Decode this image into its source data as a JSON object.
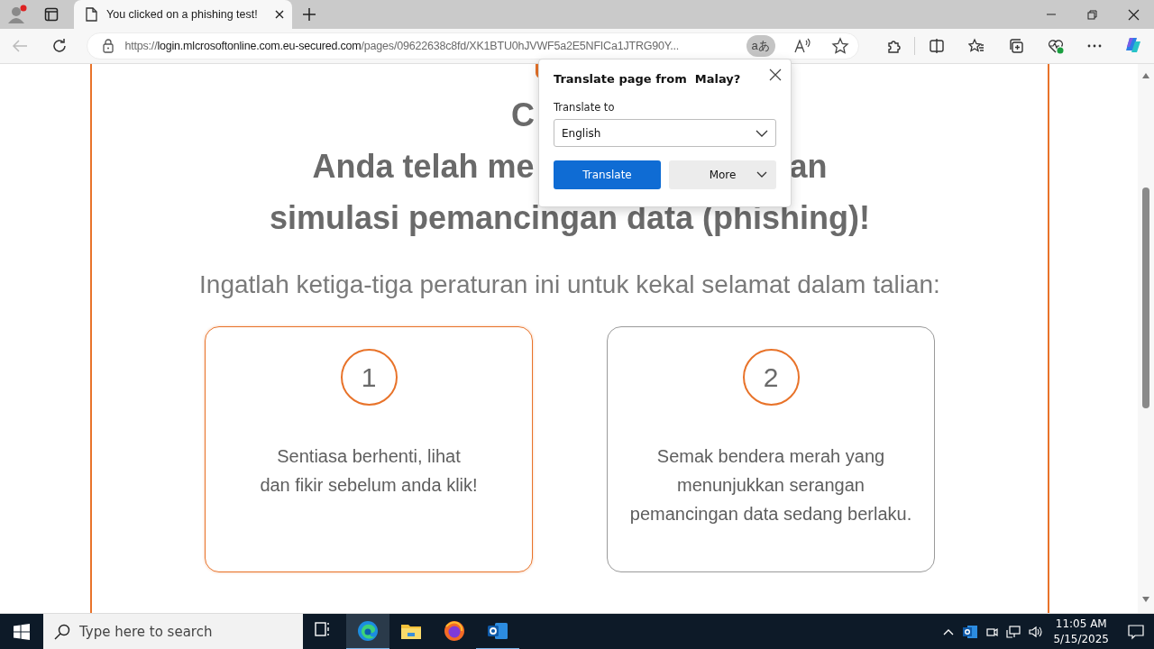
{
  "browser": {
    "tabs": [
      {
        "title": "You clicked on a phishing test!",
        "selected": true
      }
    ],
    "address": {
      "scheme": "https://",
      "host": "login.mlcrosoftonline.com.eu-secured.com",
      "path": "/pages/09622638c8fd/XK1BTU0hJVWF5a2E5NFICa1JTRG90Y..."
    },
    "translate_badge": "aあ"
  },
  "page": {
    "heading": {
      "line_1": "C",
      "line_2_left": "Anda telah me",
      "line_2_right": "an",
      "line_3": "simulasi pemancingan data (phishing)!"
    },
    "subtitle": "Ingatlah ketiga-tiga peraturan ini untuk kekal selamat dalam talian:",
    "cards": [
      {
        "number": "1",
        "text": "Sentiasa berhenti, lihat\ndan fikir sebelum anda klik!",
        "highlighted": true
      },
      {
        "number": "2",
        "text": "Semak bendera merah yang\nmenunjukkan serangan\npemancingan data sedang berlaku.",
        "highlighted": false
      }
    ]
  },
  "translate_popup": {
    "title": "Translate page from  Malay?",
    "label": "Translate to",
    "language": "English",
    "buttons": [
      {
        "label": "Translate",
        "kind": "primary"
      },
      {
        "label": "More",
        "kind": "menu"
      }
    ]
  },
  "taskbar": {
    "search_placeholder": "Type here to search",
    "apps": [
      {
        "kind": "taskview",
        "active": false,
        "running": false
      },
      {
        "kind": "edge",
        "active": true,
        "running": true
      },
      {
        "kind": "explorer",
        "active": false,
        "running": false
      },
      {
        "kind": "firefox",
        "active": false,
        "running": false
      },
      {
        "kind": "outlook",
        "active": false,
        "running": true
      }
    ],
    "time": "11:05 AM",
    "date": "5/15/2025"
  }
}
